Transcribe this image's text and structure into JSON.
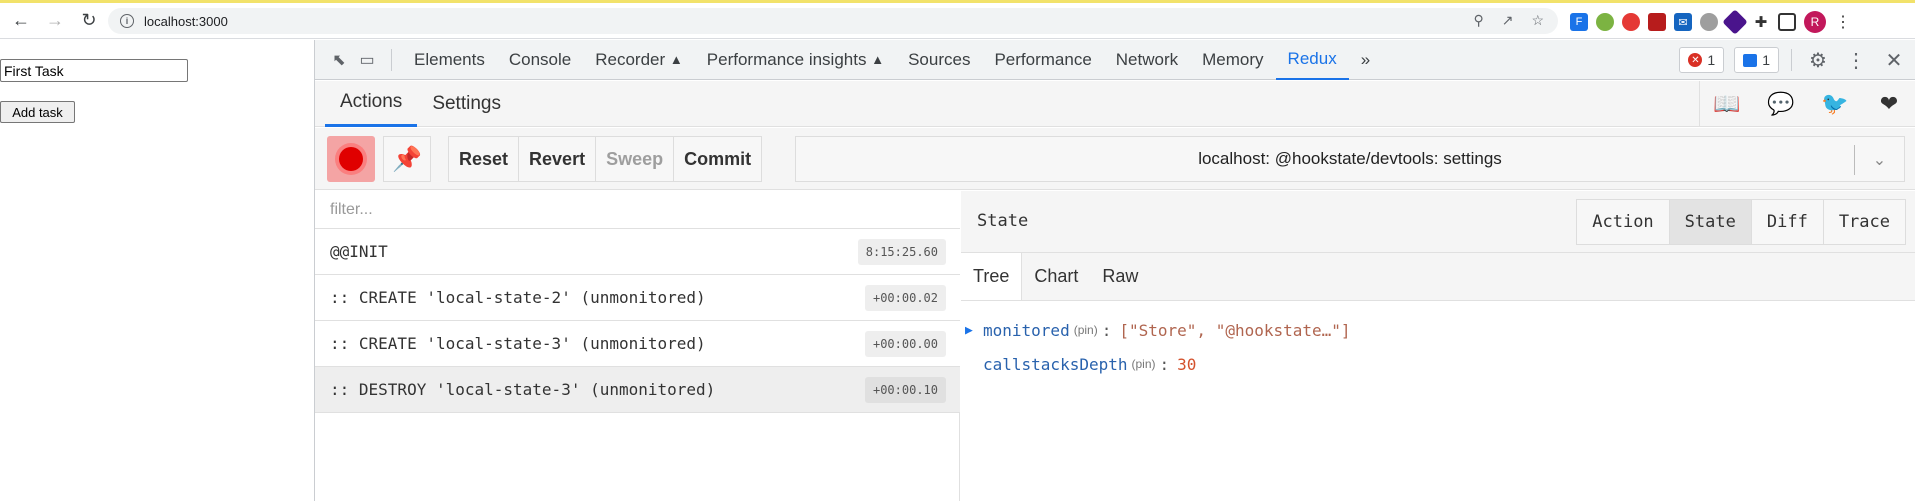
{
  "browser": {
    "url": "localhost:3000",
    "avatar_letter": "R"
  },
  "app": {
    "task_input_value": "First Task",
    "add_task_label": "Add task"
  },
  "devtools": {
    "tabs": [
      "Elements",
      "Console",
      "Recorder",
      "Performance insights",
      "Sources",
      "Performance",
      "Network",
      "Memory",
      "Redux"
    ],
    "active_tab": "Redux",
    "error_count": "1",
    "message_count": "1"
  },
  "redux": {
    "subtabs": [
      "Actions",
      "Settings"
    ],
    "controls": {
      "reset": "Reset",
      "revert": "Revert",
      "sweep": "Sweep",
      "commit": "Commit"
    },
    "instance": "localhost: @hookstate/devtools: settings",
    "filter_placeholder": "filter...",
    "actions": [
      {
        "name": "@@INIT",
        "time": "8:15:25.60"
      },
      {
        "name": ":: CREATE 'local-state-2' (unmonitored)",
        "time": "+00:00.02"
      },
      {
        "name": ":: CREATE 'local-state-3' (unmonitored)",
        "time": "+00:00.00"
      },
      {
        "name": ":: DESTROY 'local-state-3' (unmonitored)",
        "time": "+00:00.10"
      }
    ],
    "monitor": {
      "title": "State",
      "tabs": [
        "Action",
        "State",
        "Diff",
        "Trace"
      ],
      "view_tabs": [
        "Tree",
        "Chart",
        "Raw"
      ],
      "tree": [
        {
          "key": "monitored",
          "pin": "(pin)",
          "value": "[\"Store\", \"@hookstate…\"]"
        },
        {
          "key": "callstacksDepth",
          "pin": "(pin)",
          "value": "30"
        }
      ]
    }
  }
}
